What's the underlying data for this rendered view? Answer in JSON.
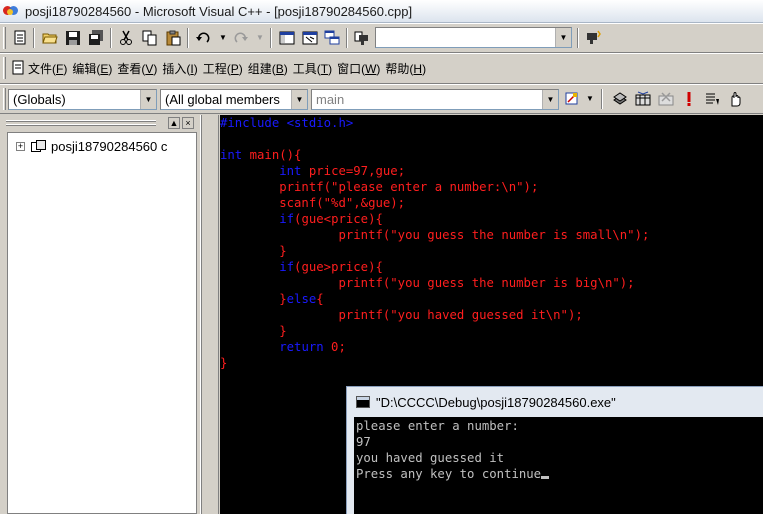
{
  "window": {
    "title": "posji18790284560 - Microsoft Visual C++ - [posji18790284560.cpp]"
  },
  "toolbar1": {
    "find_combo_value": "",
    "icons": [
      "new-text-file-icon",
      "open-folder-icon",
      "save-icon",
      "save-all-icon",
      "cut-icon",
      "copy-icon",
      "paste-icon",
      "undo-icon",
      "redo-icon",
      "workspace-icon",
      "output-icon",
      "window-list-icon",
      "find-in-files-icon",
      "find-icon"
    ]
  },
  "menu": {
    "items": [
      {
        "text": "文件(",
        "key": "F",
        "end": ")"
      },
      {
        "text": "编辑(",
        "key": "E",
        "end": ")"
      },
      {
        "text": "查看(",
        "key": "V",
        "end": ")"
      },
      {
        "text": "插入(",
        "key": "I",
        "end": ")"
      },
      {
        "text": "工程(",
        "key": "P",
        "end": ")"
      },
      {
        "text": "组建(",
        "key": "B",
        "end": ")"
      },
      {
        "text": "工具(",
        "key": "T",
        "end": ")"
      },
      {
        "text": "窗口(",
        "key": "W",
        "end": ")"
      },
      {
        "text": "帮助(",
        "key": "H",
        "end": ")"
      }
    ]
  },
  "toolbar3": {
    "scope_combo": "(Globals)",
    "members_combo": "(All global members",
    "function_combo": "main",
    "icons": [
      "wizard-action-icon",
      "compile-icon",
      "build-icon",
      "stop-build-icon",
      "execute-icon",
      "insert-breakpoint-icon",
      "go-icon"
    ]
  },
  "workspace": {
    "tree_item": "posji18790284560 c"
  },
  "editor": {
    "lines": [
      [
        {
          "t": "#include <stdio.h>",
          "c": "pp"
        }
      ],
      [],
      [
        {
          "t": "int",
          "c": "kw"
        },
        {
          "t": " main(){",
          "c": ""
        }
      ],
      [
        {
          "t": "        ",
          "c": ""
        },
        {
          "t": "int",
          "c": "kw"
        },
        {
          "t": " price=97,gue;",
          "c": ""
        }
      ],
      [
        {
          "t": "        printf(\"please enter a number:\\n\");",
          "c": ""
        }
      ],
      [
        {
          "t": "        scanf(\"%d\",&gue);",
          "c": ""
        }
      ],
      [
        {
          "t": "        ",
          "c": ""
        },
        {
          "t": "if",
          "c": "kw"
        },
        {
          "t": "(gue<price){",
          "c": ""
        }
      ],
      [
        {
          "t": "                printf(\"you guess the number is small\\n\");",
          "c": ""
        }
      ],
      [
        {
          "t": "        }",
          "c": ""
        }
      ],
      [
        {
          "t": "        ",
          "c": ""
        },
        {
          "t": "if",
          "c": "kw"
        },
        {
          "t": "(gue>price){",
          "c": ""
        }
      ],
      [
        {
          "t": "                printf(\"you guess the number is big\\n\");",
          "c": ""
        }
      ],
      [
        {
          "t": "        }",
          "c": ""
        },
        {
          "t": "else",
          "c": "kw"
        },
        {
          "t": "{",
          "c": ""
        }
      ],
      [
        {
          "t": "                printf(\"you haved guessed it\\n\");",
          "c": ""
        }
      ],
      [
        {
          "t": "        }",
          "c": ""
        }
      ],
      [
        {
          "t": "        ",
          "c": ""
        },
        {
          "t": "return",
          "c": "kw"
        },
        {
          "t": " 0;",
          "c": ""
        }
      ],
      [
        {
          "t": "}",
          "c": ""
        }
      ]
    ]
  },
  "console": {
    "title": "\"D:\\CCCC\\Debug\\posji18790284560.exe\"",
    "lines": [
      "please enter a number:",
      "97",
      "you haved guessed it",
      "Press any key to continue"
    ]
  },
  "colors": {
    "code_text": "#ff1e1e",
    "keyword": "#1a1aff",
    "editor_bg": "#000000",
    "console_text": "#c0c0c0"
  }
}
